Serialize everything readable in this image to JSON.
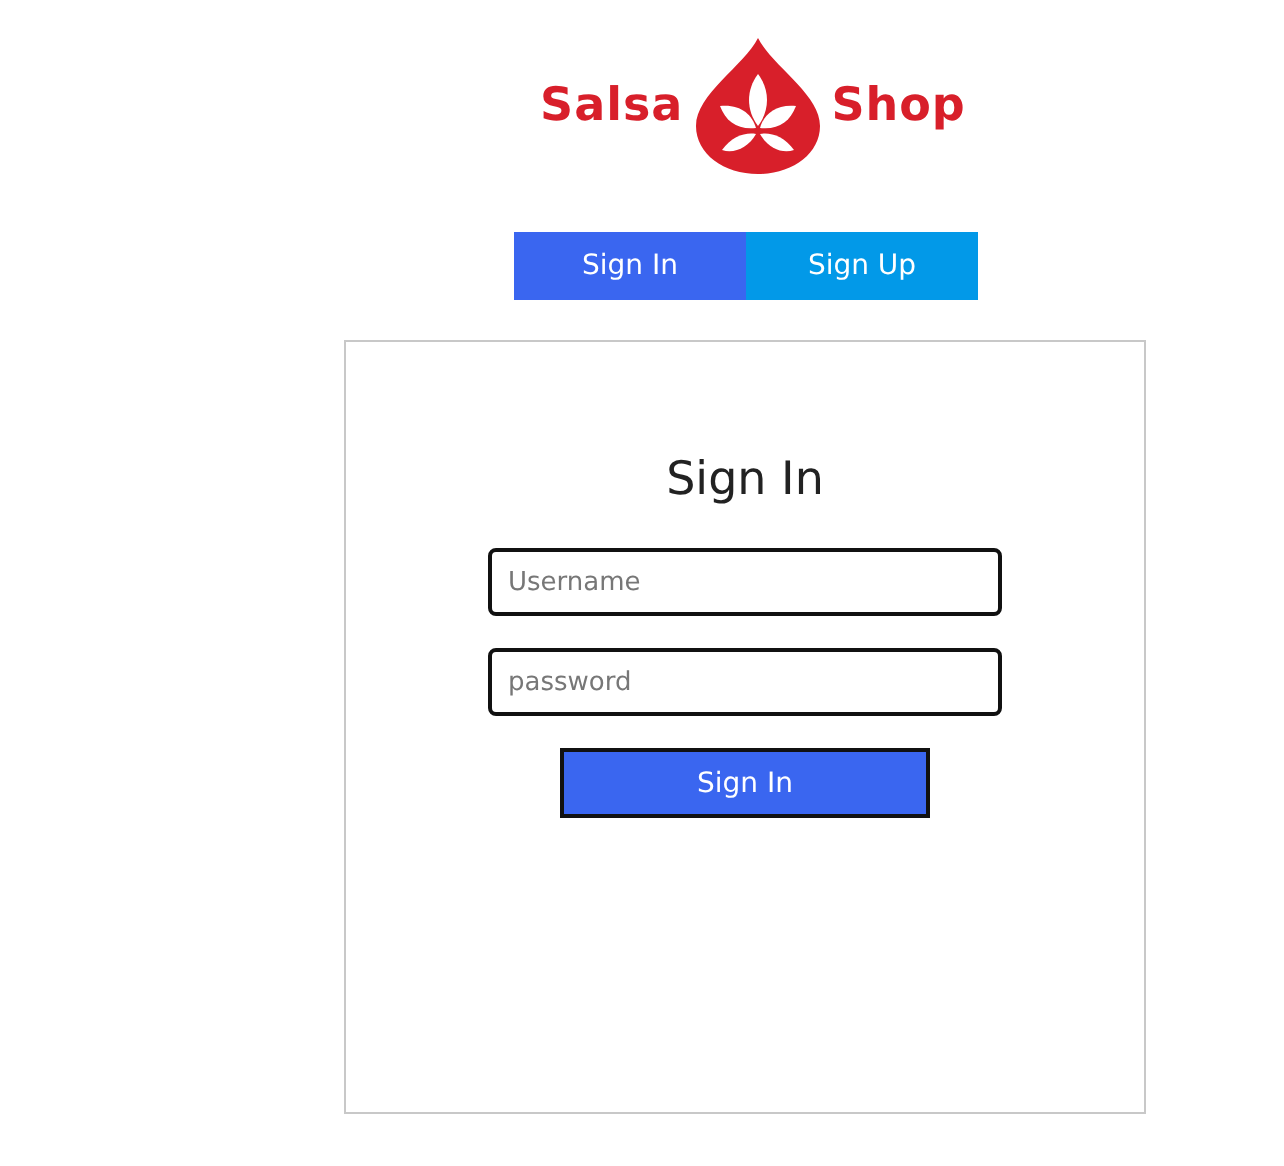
{
  "logo": {
    "left_word": "Salsa",
    "right_word": "Shop"
  },
  "tabs": [
    {
      "label": "Sign In",
      "selected": true
    },
    {
      "label": "Sign Up",
      "selected": false
    }
  ],
  "form": {
    "title": "Sign In",
    "fields": [
      {
        "placeholder": "Username"
      },
      {
        "placeholder": "password"
      }
    ],
    "button": "Sign In"
  }
}
